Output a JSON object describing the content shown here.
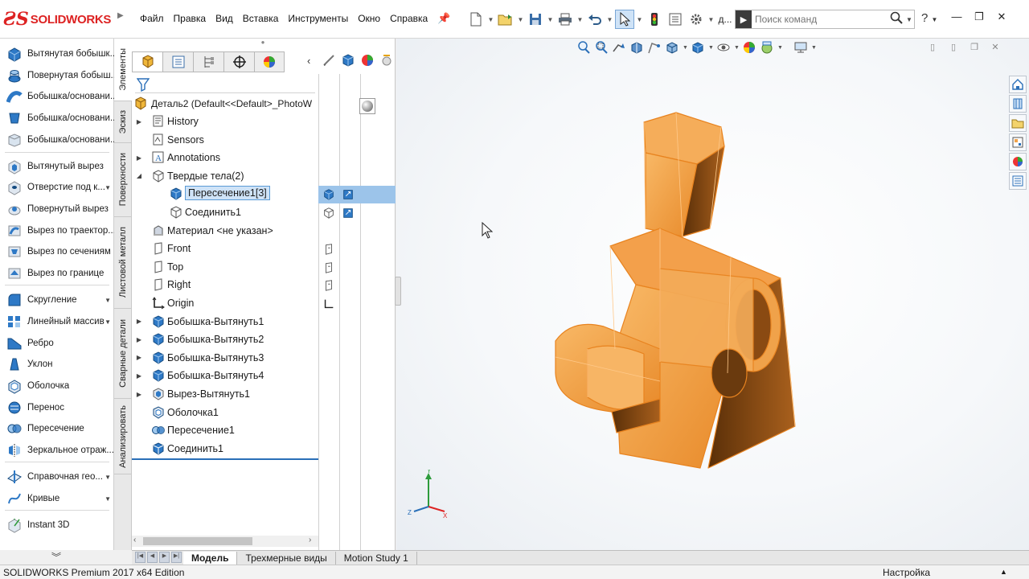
{
  "app": {
    "logo_text": "SOLIDWORKS",
    "status_left": "SOLIDWORKS Premium 2017 x64 Edition",
    "status_right": "Настройка"
  },
  "menu": [
    "Файл",
    "Правка",
    "Вид",
    "Вставка",
    "Инструменты",
    "Окно",
    "Справка"
  ],
  "search": {
    "placeholder": "Поиск команд",
    "lead_label": "д..."
  },
  "command_manager": [
    {
      "label": "Вытянутая бобышк...",
      "icon": "extruded-boss-icon",
      "dd": false
    },
    {
      "label": "Повернутая бобыш...",
      "icon": "revolved-boss-icon",
      "dd": false
    },
    {
      "label": "Бобышка/основани...",
      "icon": "swept-boss-icon",
      "dd": false
    },
    {
      "label": "Бобышка/основани...",
      "icon": "lofted-boss-icon",
      "dd": false
    },
    {
      "label": "Бобышка/основани...",
      "icon": "boundary-boss-icon",
      "dd": false
    },
    {
      "label": "Вытянутый вырез",
      "icon": "extruded-cut-icon",
      "dd": false
    },
    {
      "label": "Отверстие под к...",
      "icon": "hole-wizard-icon",
      "dd": true
    },
    {
      "label": "Повернутый вырез",
      "icon": "revolved-cut-icon",
      "dd": false
    },
    {
      "label": "Вырез по траектор...",
      "icon": "swept-cut-icon",
      "dd": false
    },
    {
      "label": "Вырез по сечениям",
      "icon": "lofted-cut-icon",
      "dd": false
    },
    {
      "label": "Вырез по границе",
      "icon": "boundary-cut-icon",
      "dd": false
    },
    {
      "label": "Скругление",
      "icon": "fillet-icon",
      "dd": true
    },
    {
      "label": "Линейный массив",
      "icon": "linear-pattern-icon",
      "dd": true
    },
    {
      "label": "Ребро",
      "icon": "rib-icon",
      "dd": false
    },
    {
      "label": "Уклон",
      "icon": "draft-icon",
      "dd": false
    },
    {
      "label": "Оболочка",
      "icon": "shell-icon",
      "dd": false
    },
    {
      "label": "Перенос",
      "icon": "wrap-icon",
      "dd": false
    },
    {
      "label": "Пересечение",
      "icon": "intersect-icon",
      "dd": false
    },
    {
      "label": "Зеркальное отраж...",
      "icon": "mirror-icon",
      "dd": false
    },
    {
      "label": "Справочная гео...",
      "icon": "reference-geometry-icon",
      "dd": true
    },
    {
      "label": "Кривые",
      "icon": "curves-icon",
      "dd": true
    },
    {
      "label": "Instant 3D",
      "icon": "instant3d-icon",
      "dd": false
    }
  ],
  "vertical_tabs": [
    "Элементы",
    "Эскиз",
    "Поверхности",
    "Листовой металл",
    "Сварные детали",
    "Анализировать"
  ],
  "feature_tree": {
    "root": "Деталь2  (Default<<Default>_PhotoW",
    "items": [
      {
        "label": "History",
        "icon": "history-icon",
        "indent": 0,
        "expand": true
      },
      {
        "label": "Sensors",
        "icon": "sensors-icon",
        "indent": 0,
        "expand": false
      },
      {
        "label": "Annotations",
        "icon": "annotations-icon",
        "indent": 0,
        "expand": true
      },
      {
        "label": "Твердые тела(2)",
        "icon": "solid-bodies-icon",
        "indent": 0,
        "expand": true,
        "open": true
      },
      {
        "label": "Пересечение1[3]",
        "icon": "body-icon",
        "indent": 1,
        "expand": false,
        "selected": true
      },
      {
        "label": "Соединить1",
        "icon": "body-outline-icon",
        "indent": 1,
        "expand": false
      },
      {
        "label": "Материал <не указан>",
        "icon": "material-icon",
        "indent": 0,
        "expand": false
      },
      {
        "label": "Front",
        "icon": "plane-icon",
        "indent": 0,
        "expand": false
      },
      {
        "label": "Top",
        "icon": "plane-icon",
        "indent": 0,
        "expand": false
      },
      {
        "label": "Right",
        "icon": "plane-icon",
        "indent": 0,
        "expand": false
      },
      {
        "label": "Origin",
        "icon": "origin-icon",
        "indent": 0,
        "expand": false
      },
      {
        "label": "Бобышка-Вытянуть1",
        "icon": "boss-extrude-icon",
        "indent": 0,
        "expand": true
      },
      {
        "label": "Бобышка-Вытянуть2",
        "icon": "boss-extrude-icon",
        "indent": 0,
        "expand": true
      },
      {
        "label": "Бобышка-Вытянуть3",
        "icon": "boss-extrude-icon",
        "indent": 0,
        "expand": true
      },
      {
        "label": "Бобышка-Вытянуть4",
        "icon": "boss-extrude-icon",
        "indent": 0,
        "expand": true
      },
      {
        "label": "Вырез-Вытянуть1",
        "icon": "cut-extrude-icon",
        "indent": 0,
        "expand": true
      },
      {
        "label": "Оболочка1",
        "icon": "shell-feature-icon",
        "indent": 0,
        "expand": false
      },
      {
        "label": "Пересечение1",
        "icon": "intersect-feature-icon",
        "indent": 0,
        "expand": false
      },
      {
        "label": "Соединить1",
        "icon": "combine-feature-icon",
        "indent": 0,
        "expand": false
      }
    ]
  },
  "bottom_tabs": [
    {
      "label": "Модель",
      "active": true
    },
    {
      "label": "Трехмерные виды",
      "active": false
    },
    {
      "label": "Motion Study 1",
      "active": false
    }
  ],
  "colors": {
    "accent": "#2a6fb8",
    "model_fill": "#f0a24a",
    "model_edge": "#e8831f",
    "selection": "#9cc4ea"
  }
}
